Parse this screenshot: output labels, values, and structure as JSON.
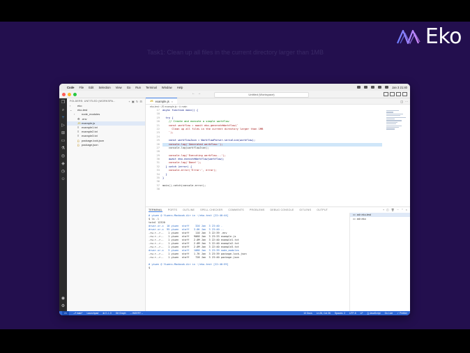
{
  "brand": {
    "name": "Eko",
    "color": "#b28cff"
  },
  "task": {
    "text": "Task1: Clean up all files in the current directory larger than 1MB"
  },
  "menubar": {
    "app": "Code",
    "items": [
      "File",
      "Edit",
      "Selection",
      "View",
      "Go",
      "Run",
      "Terminal",
      "Window",
      "Help"
    ],
    "clock": "Jan 3  21:40"
  },
  "titlebar": {
    "command_center": "Untitled (Workspace)"
  },
  "sidebar": {
    "header": "FOLDERS: UNTITLED (WORKSPA...",
    "items": [
      {
        "label": "eko",
        "indent": 0,
        "caret": "›",
        "icon": ""
      },
      {
        "label": "eko-test",
        "indent": 0,
        "caret": "⌄",
        "icon": ""
      },
      {
        "label": "node_modules",
        "indent": 1,
        "caret": "›",
        "icon": ""
      },
      {
        "label": ".env",
        "indent": 1,
        "caret": "",
        "icon": "⚙"
      },
      {
        "label": "example.js",
        "indent": 1,
        "caret": "",
        "icon": "JS",
        "selected": true
      },
      {
        "label": "example1.txt",
        "indent": 1,
        "caret": "",
        "icon": "≡"
      },
      {
        "label": "example2.txt",
        "indent": 1,
        "caret": "",
        "icon": "≡"
      },
      {
        "label": "example3.txt",
        "indent": 1,
        "caret": "",
        "icon": "≡"
      },
      {
        "label": "package-lock.json",
        "indent": 1,
        "caret": "",
        "icon": "{}"
      },
      {
        "label": "package.json",
        "indent": 1,
        "caret": "",
        "icon": "{}"
      }
    ]
  },
  "editor": {
    "tab": "example.js",
    "breadcrumb": "eko-test › JS example.js › ⊙ main",
    "lines": [
      {
        "n": "17",
        "text": "async function main() {"
      },
      {
        "n": "18",
        "text": ""
      },
      {
        "n": "19",
        "text": "  try {"
      },
      {
        "n": "20",
        "text": "    // Create and execute a simple workflow"
      },
      {
        "n": "21",
        "text": "    const workflow = await eko.generateWorkflow(`"
      },
      {
        "n": "22",
        "text": "      Clean up all files in the current directory larger than 1MB"
      },
      {
        "n": "23",
        "text": "    `);"
      },
      {
        "n": "24",
        "text": ""
      },
      {
        "n": "25",
        "text": "    const workflowJson = WorkflowParser.serialize(workflow);"
      },
      {
        "n": "26",
        "text": "    console.log('Generated workflow:');"
      },
      {
        "n": "27",
        "text": "    console.log(workflowJson);"
      },
      {
        "n": "28",
        "text": ""
      },
      {
        "n": "29",
        "text": "    console.log('Executing workflow...');"
      },
      {
        "n": "30",
        "text": "    await eko.executeWorkflow(workflow);"
      },
      {
        "n": "31",
        "text": "    console.log('Done!');"
      },
      {
        "n": "32",
        "text": "  } catch (error) {"
      },
      {
        "n": "33",
        "text": "    console.error('Error:', error);"
      },
      {
        "n": "34",
        "text": "  }"
      },
      {
        "n": "35",
        "text": "}"
      },
      {
        "n": "36",
        "text": ""
      },
      {
        "n": "37",
        "text": "main().catch(console.error);"
      },
      {
        "n": "38",
        "text": ""
      }
    ]
  },
  "panel": {
    "tabs": [
      "TERMINAL",
      "PORTS",
      "OUTLINE",
      "SPELL CHECKER",
      "COMMENTS",
      "PROBLEMS",
      "DEBUG CONSOLE",
      "GITLENS",
      "OUTPUT"
    ],
    "terminal_lines": [
      "# yiwen @ Yiwens-Macbook-Air in ~/eko-test [22:40:44]",
      "$ ls -l",
      "total 12320",
      "drwxr-xr-x  10 yiwen  staff    320 Jan  3 23:40 .",
      "drwxr-xr-x  95 yiwen  staff   3.0K Jan  3 23:40 ..",
      "-rw-r--r--   1 yiwen  staff    110 Jan  3 22:39 .env",
      "-rw-r--r--   1 yiwen  staff   9068 Jan  3 23:33 example.js",
      "-rw-r--r--   1 yiwen  staff   2.0M Jan  3 22:40 example1.txt",
      "-rw-r--r--   1 yiwen  staff   2.0M Jan  3 22:40 example2.txt",
      "-rw-r--r--   1 yiwen  staff   2.0M Jan  3 22:40 example3.txt",
      "drwxr-xr-x   3 yiwen  staff   1088 Jan  3 23:39 node_modules",
      "-rw-r--r--   1 yiwen  staff   1.7K Jan  3 23:39 package-lock.json",
      "-rw-r--r--   1 yiwen  staff    728 Jan  3 23:40 package.json",
      "",
      "# yiwen @ Yiwens-Macbook-Air in ~/eko-test [22:40:59]",
      "$ "
    ],
    "terminals": [
      "zsh eko-test",
      "zsh eko"
    ]
  },
  "statusbar": {
    "left": [
      "⎇ main*",
      "Launchpad",
      "⊗ 0 ⚠ 0",
      "Git Graph",
      "-- INSERT --"
    ],
    "right": [
      "10 Docs",
      "Ln 26, Col 26",
      "Spaces: 2",
      "UTF-8",
      "LF",
      "{} JavaScript",
      "Go Live",
      "✓ Prettier"
    ]
  }
}
